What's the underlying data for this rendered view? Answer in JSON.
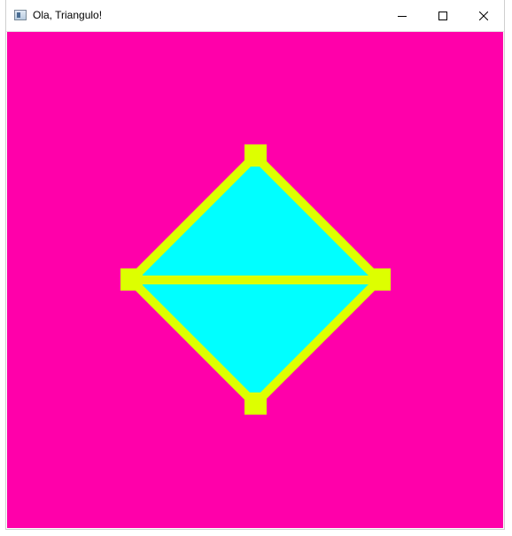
{
  "window": {
    "title": "Ola, Triangulo!",
    "icon": "app-window-icon",
    "controls": {
      "minimize_icon": "minimize-icon",
      "maximize_icon": "maximize-icon",
      "close_icon": "close-icon"
    }
  },
  "canvas": {
    "background_color": "#ff00aa",
    "fill_color": "#00ffff",
    "edge_color": "#ddff00",
    "vertex_color": "#ddff00"
  }
}
